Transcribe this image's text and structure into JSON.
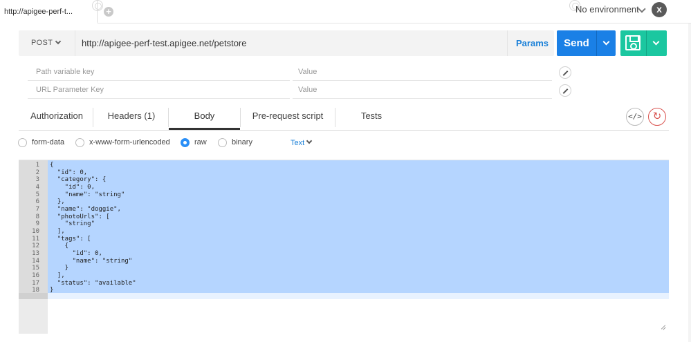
{
  "tab": {
    "title": "http://apigee-perf-t...",
    "add_icon": "+"
  },
  "environment": {
    "selected": "No environment",
    "close_icon": "x"
  },
  "request": {
    "method": "POST",
    "url": "http://apigee-perf-test.apigee.net/petstore",
    "params_label": "Params",
    "send_label": "Send"
  },
  "path_params": [
    {
      "key_placeholder": "Path variable key",
      "value_placeholder": "Value"
    },
    {
      "key_placeholder": "URL Parameter Key",
      "value_placeholder": "Value"
    }
  ],
  "request_tabs": [
    "Authorization",
    "Headers (1)",
    "Body",
    "Pre-request script",
    "Tests"
  ],
  "active_tab": "Body",
  "code_icon_label": "</>",
  "body_modes": {
    "options": [
      "form-data",
      "x-www-form-urlencoded",
      "raw",
      "binary"
    ],
    "selected": "raw",
    "text_type": "Text"
  },
  "editor": {
    "lines": [
      "{",
      "  \"id\": 0,",
      "  \"category\": {",
      "    \"id\": 0,",
      "    \"name\": \"string\"",
      "  },",
      "  \"name\": \"doggie\",",
      "  \"photoUrls\": [",
      "    \"string\"",
      "  ],",
      "  \"tags\": [",
      "    {",
      "      \"id\": 0,",
      "      \"name\": \"string\"",
      "    }",
      "  ],",
      "  \"status\": \"available\"",
      "}"
    ],
    "line_numbers": [
      "1",
      "2",
      "3",
      "4",
      "5",
      "6",
      "7",
      "8",
      "9",
      "10",
      "11",
      "12",
      "13",
      "14",
      "15",
      "16",
      "17",
      "18"
    ]
  },
  "colors": {
    "send": "#1a80e6",
    "save": "#1bc7a0",
    "selection": "#b5d5ff",
    "link": "#1a80d8",
    "reset": "#d9534f"
  }
}
